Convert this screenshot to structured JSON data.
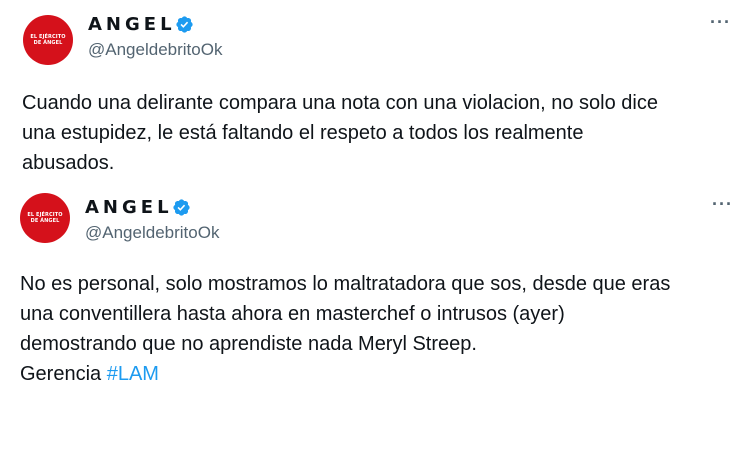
{
  "tweets": [
    {
      "avatar_text": [
        "EL EJÉRCITO",
        "DE ÁNGEL"
      ],
      "display_name": "ANGEL",
      "handle": "@AngeldebritoOk",
      "more_label": "···",
      "text_lines": [
        "Cuando una delirante compara una nota con una violacion, no solo dice",
        "una estupidez, le está faltando el respeto a todos los realmente",
        "abusados."
      ]
    },
    {
      "avatar_text": [
        "EL EJÉRCITO",
        "DE ÁNGEL"
      ],
      "display_name": "ANGEL",
      "handle": "@AngeldebritoOk",
      "more_label": "···",
      "text_lines": [
        "No es personal, solo mostramos lo maltratadora que sos, desde que eras",
        "una conventillera hasta ahora en masterchef o intrusos (ayer)",
        "demostrando que no aprendiste nada Meryl Streep."
      ],
      "signature": "Gerencia",
      "hashtag": "#LAM"
    }
  ],
  "colors": {
    "verified_badge": "#1d9bf0",
    "avatar_bg": "#d5111b",
    "hashtag": "#1d9bf0",
    "secondary_text": "#536471"
  },
  "icons": {
    "verified": "verified-badge-icon",
    "more": "more-options-icon"
  }
}
